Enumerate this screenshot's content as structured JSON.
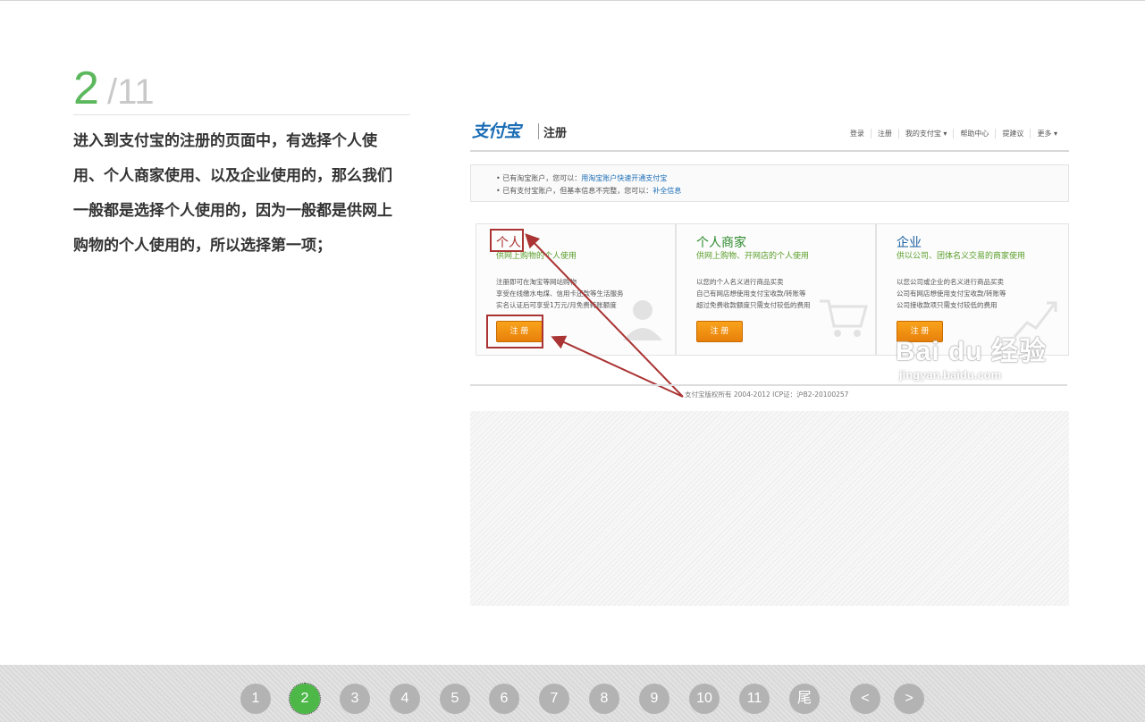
{
  "step": {
    "current": "2",
    "total": "/11"
  },
  "description": "进入到支付宝的注册的页面中，有选择个人使用、个人商家使用、以及企业使用的，那么我们一般都是选择个人使用的，因为一般都是供网上购物的个人使用的，所以选择第一项；",
  "screenshot": {
    "logo": "支付宝",
    "logo_sub": "注册",
    "nav": [
      "登录",
      "注册",
      "我的支付宝 ▾",
      "帮助中心",
      "提建议",
      "更多 ▾"
    ],
    "notice": {
      "line1_prefix": "• 已有淘宝账户，您可以：",
      "line1_link": "用淘宝账户快速开通支付宝",
      "line2_prefix": "• 已有支付宝账户，但基本信息不完整，您可以：",
      "line2_link": "补全信息"
    },
    "cards": [
      {
        "title": "个人",
        "subtitle": "供网上购物的个人使用",
        "body": [
          "注册即可在淘宝等网站购物",
          "享受在线缴水电煤、信用卡还款等生活服务",
          "实名认证后可享受1万元/月免费转账额度"
        ],
        "button": "注 册"
      },
      {
        "title": "个人商家",
        "subtitle": "供网上购物、开网店的个人使用",
        "body": [
          "以您的个人名义进行商品买卖",
          "自己有网店想使用支付宝收款/转账等",
          "超过免费收款额度只需支付较低的费用"
        ],
        "button": "注 册"
      },
      {
        "title": "企业",
        "subtitle": "供以公司、团体名义交易的商家使用",
        "body": [
          "以您公司或企业的名义进行商品买卖",
          "公司有网店想使用支付宝收款/转账等",
          "公司接收款项只需支付较低的费用"
        ],
        "button": "注 册"
      }
    ],
    "footer": "支付宝版权所有 2004-2012 ICP证：沪B2-20100257",
    "watermark": "Bai du 经验",
    "watermark_url": "jingyan.baidu.com"
  },
  "pager": {
    "pages": [
      "1",
      "2",
      "3",
      "4",
      "5",
      "6",
      "7",
      "8",
      "9",
      "10",
      "11",
      "尾"
    ],
    "active": "2",
    "prev": "<",
    "next": ">"
  },
  "colors": {
    "accent_green": "#4db848",
    "page_dot": "#b3b3b3",
    "annotation_red": "#a33333"
  }
}
